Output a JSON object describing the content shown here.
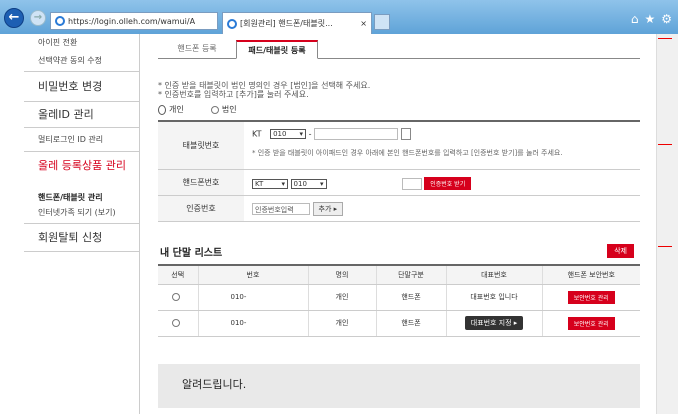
{
  "browser": {
    "url": "https://login.olleh.com/wamui/A",
    "tab_title": "[회원관리] 핸드폰/태블릿...",
    "back_glyph": "←",
    "forward_glyph": "→",
    "home_icon": "⌂",
    "star_icon": "★",
    "gear_icon": "⚙",
    "tab_close": "×"
  },
  "sidebar": {
    "items": [
      {
        "label": "아이핀 전환",
        "style": "small"
      },
      {
        "label": "선택약관 동의 수정",
        "style": "small"
      },
      {
        "label": "비밀번호 변경",
        "style": "big"
      },
      {
        "label": "올레ID 관리",
        "style": "big"
      },
      {
        "label": "멀티로그인 ID 관리",
        "style": "small"
      },
      {
        "label": "올레 등록상품 관리",
        "style": "red"
      },
      {
        "label": "핸드폰/태블릿 관리",
        "style": "bold"
      },
      {
        "label": "인터넷가족 되기 (보기)",
        "style": "small"
      },
      {
        "label": "회원탈퇴 신청",
        "style": "big"
      }
    ]
  },
  "tabs": {
    "phone": "핸드폰 등록",
    "pad": "패드/태블릿 등록"
  },
  "notes": {
    "line1": "* 인증 받을 태블릿이 법인 명의인 경우 [법인]을 선택해 주세요.",
    "line2": "* 인증번호를 입력하고 [추가]를 눌러 주세요."
  },
  "owner_radio": {
    "personal": "개인",
    "corporate": "법인"
  },
  "form": {
    "tablet_label": "태블릿번호",
    "carrier": "KT",
    "prefix": "010",
    "dash": "-",
    "tablet_hint": "* 인증 받을 태블릿이 아이패드인 경우 아래에 본인 핸드폰번호를 입력하고 [인증번호 받기]를 눌러 주세요.",
    "phone_label": "핸드폰번호",
    "phone_carrier": "KT",
    "phone_prefix": "010",
    "get_code_button": "인증번호 받기",
    "code_label": "인증번호",
    "code_placeholder": "인증번호입력",
    "add_button": "추가 ▸"
  },
  "list": {
    "title": "내 단말 리스트",
    "delete_button": "삭제",
    "headers": [
      "선택",
      "번호",
      "명의",
      "단말구분",
      "대표번호",
      "핸드폰 보안번호"
    ],
    "rows": [
      {
        "number": "010-",
        "owner": "개인",
        "type": "핸드폰",
        "rep": "대표번호 입니다",
        "rep_is_button": false,
        "security": "보안번호 관리"
      },
      {
        "number": "010-",
        "owner": "개인",
        "type": "핸드폰",
        "rep": "대표번호 지정 ▸",
        "rep_is_button": true,
        "security": "보안번호 관리"
      }
    ]
  },
  "notice": {
    "title": "알려드립니다."
  },
  "colors": {
    "accent": "#d6001c",
    "browser_blue": "#5fa3d8"
  }
}
